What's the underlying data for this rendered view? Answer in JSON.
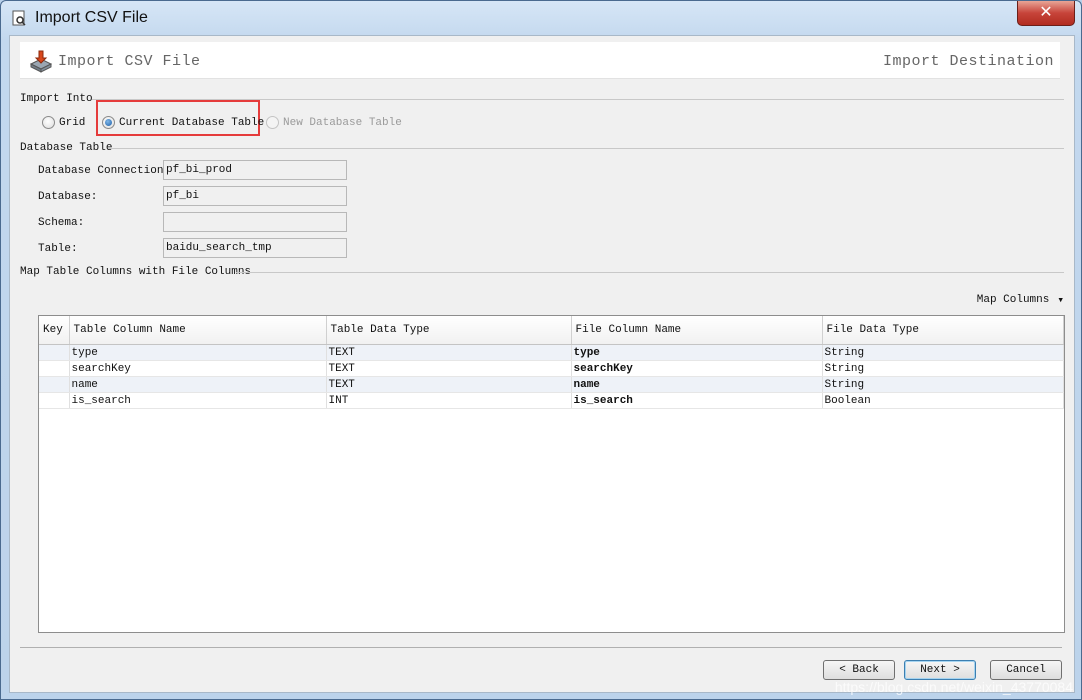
{
  "window": {
    "title": "Import CSV File"
  },
  "banner": {
    "title": "Import CSV File",
    "right_title": "Import Destination"
  },
  "import_into": {
    "section": "Import Into",
    "options": [
      {
        "label": "Grid",
        "selected": false,
        "enabled": true
      },
      {
        "label": "Current Database Table",
        "selected": true,
        "enabled": true
      },
      {
        "label": "New Database Table",
        "selected": false,
        "enabled": false
      }
    ]
  },
  "database_table": {
    "section": "Database Table",
    "fields": [
      {
        "label": "Database Connection:",
        "value": "pf_bi_prod"
      },
      {
        "label": "Database:",
        "value": "pf_bi"
      },
      {
        "label": "Schema:",
        "value": ""
      },
      {
        "label": "Table:",
        "value": "baidu_search_tmp"
      }
    ]
  },
  "mapping": {
    "section": "Map Table Columns with File Columns",
    "map_columns_label": "Map Columns",
    "headers": [
      "Key",
      "Table Column Name",
      "Table Data Type",
      "File Column Name",
      "File Data Type"
    ],
    "rows": [
      [
        "",
        "type",
        "TEXT",
        "type",
        "String"
      ],
      [
        "",
        "searchKey",
        "TEXT",
        "searchKey",
        "String"
      ],
      [
        "",
        "name",
        "TEXT",
        "name",
        "String"
      ],
      [
        "",
        "is_search",
        "INT",
        "is_search",
        "Boolean"
      ]
    ]
  },
  "buttons": {
    "back": "< Back",
    "next": "Next >",
    "cancel": "Cancel"
  },
  "watermark": "https://blog.csdn.net/weixin_43770084"
}
